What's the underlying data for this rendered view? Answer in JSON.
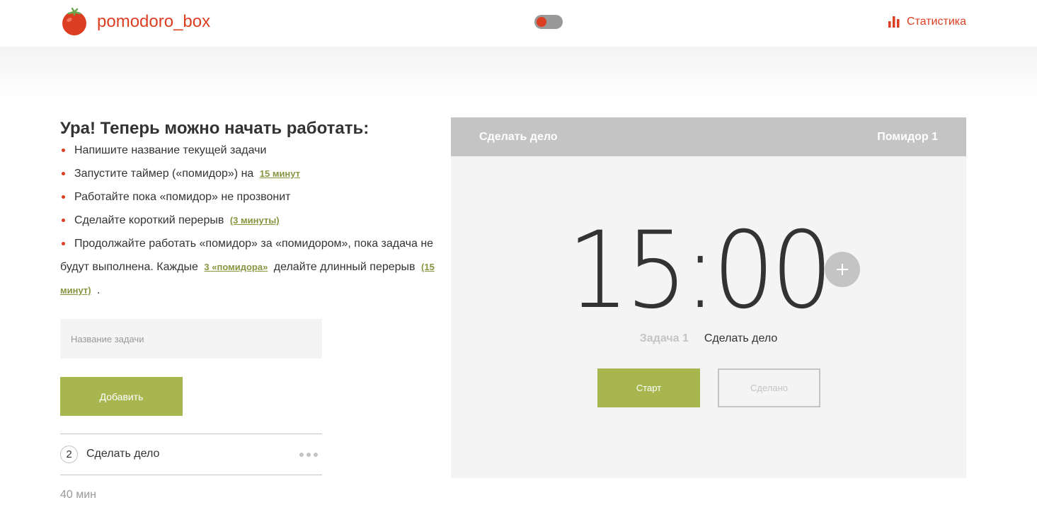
{
  "app": {
    "logo_text": "pomodoro_box",
    "logo_icon": "tomato-icon",
    "stats_label": "Статистика",
    "stats_icon": "bar-chart-icon",
    "theme_toggle_on": false
  },
  "colors": {
    "brand_red": "#dc3e22",
    "accent_green": "#a8b64f",
    "link_green": "#899441",
    "gray": "#c4c4c4",
    "panel_bg": "#f4f4f4"
  },
  "instructions": {
    "title": "Ура! Теперь можно начать работать:",
    "step1": "Напишите название текущей задачи",
    "step2_text": "Запустите таймер («помидор») на",
    "step2_link": "15 минут",
    "step3": "Работайте пока «помидор» не прозвонит",
    "step4_text": "Сделайте короткий перерыв",
    "step4_link": "(3 минуты)",
    "step5_text_a": "Продолжайте работать «помидор» за «помидором», пока задача не будут выполнена. Каждые",
    "step5_link_a": "3 «помидора»",
    "step5_text_b": "делайте длинный перерыв",
    "step5_link_b": "(15 минут)",
    "step5_end": "."
  },
  "form": {
    "task_placeholder": "Название задачи",
    "add_label": "Добавить"
  },
  "task_list": {
    "items": [
      {
        "count": "2",
        "name": "Сделать дело",
        "menu_icon": "more-dots-icon"
      }
    ],
    "total_time": "40 мин"
  },
  "timer": {
    "header_task": "Сделать дело",
    "header_pomodoro": "Помидор 1",
    "time": "15:00",
    "plus_icon": "plus-icon",
    "task_label": "Задача 1",
    "task_name": "Сделать дело",
    "start_label": "Старт",
    "done_label": "Сделано"
  }
}
